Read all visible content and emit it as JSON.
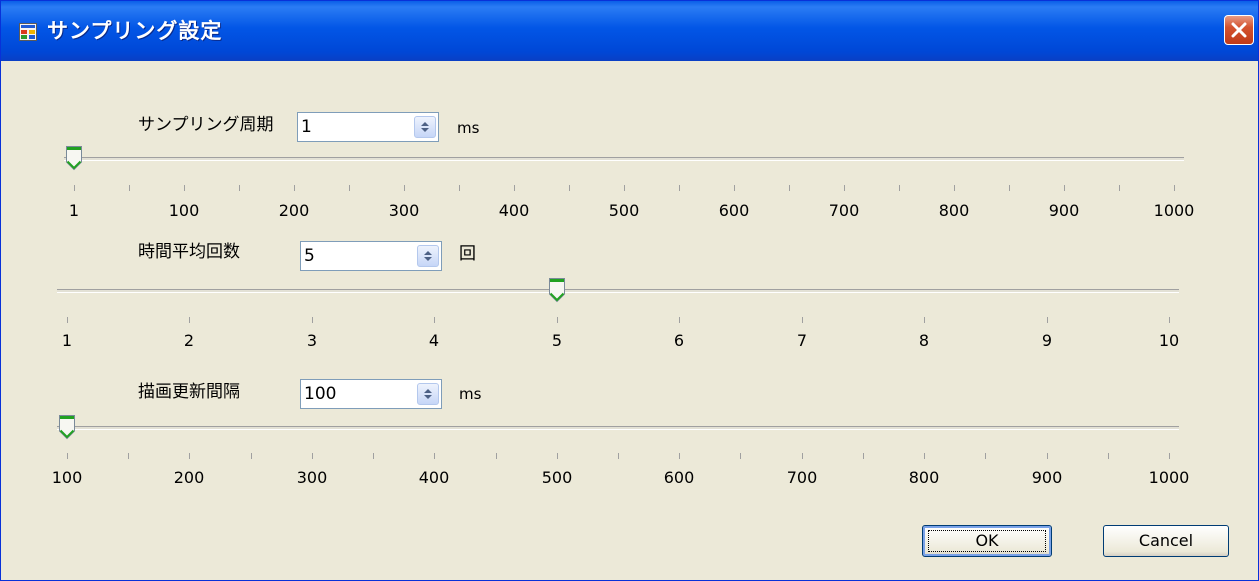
{
  "window": {
    "title": "サンプリング設定"
  },
  "sampling_period": {
    "label": "サンプリング周期",
    "value": "1",
    "unit": "ms",
    "slider": {
      "min": 1,
      "max": 1000,
      "value": 1,
      "tick_count": 21
    },
    "tick_labels": [
      "1",
      "100",
      "200",
      "300",
      "400",
      "500",
      "600",
      "700",
      "800",
      "900",
      "1000"
    ]
  },
  "time_average": {
    "label": "時間平均回数",
    "value": "5",
    "unit": "回",
    "slider": {
      "min": 1,
      "max": 10,
      "value": 5,
      "tick_count": 10
    },
    "tick_labels": [
      "1",
      "2",
      "3",
      "4",
      "5",
      "6",
      "7",
      "8",
      "9",
      "10"
    ]
  },
  "draw_interval": {
    "label": "描画更新間隔",
    "value": "100",
    "unit": "ms",
    "slider": {
      "min": 100,
      "max": 1000,
      "value": 100,
      "tick_count": 19
    },
    "tick_labels": [
      "100",
      "200",
      "300",
      "400",
      "500",
      "600",
      "700",
      "800",
      "900",
      "1000"
    ]
  },
  "buttons": {
    "ok": "OK",
    "cancel": "Cancel"
  },
  "colors": {
    "title_bar": "#0054e3",
    "dialog_bg": "#ece9d8",
    "thumb_accent": "#21a121",
    "close_button": "#d4532f"
  },
  "icons": {
    "app": "app-window-icon",
    "close": "close-icon",
    "spin": "spin-updown-icon",
    "thumb": "slider-thumb-icon"
  }
}
